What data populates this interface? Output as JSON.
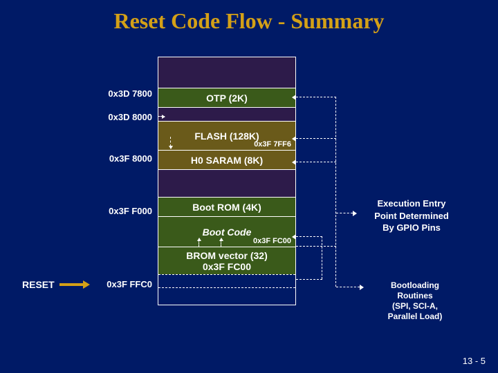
{
  "title": "Reset Code Flow - Summary",
  "addresses": {
    "otp": "0x3D 7800",
    "gap2": "0x3D 8000",
    "h0saram": "0x3F 8000",
    "bootrom": "0x3F F000",
    "bromvec": "0x3F FFC0"
  },
  "blocks": {
    "otp": "OTP (2K)",
    "flash": "FLASH (128K)",
    "flash_end_addr": "0x3F 7FF6",
    "h0saram": "H0 SARAM (8K)",
    "bootrom": "Boot ROM (4K)",
    "bootcode": "Boot Code",
    "bootcode_addr": "0x3F FC00",
    "bromvec_l1": "BROM vector (32)",
    "bromvec_l2": "0x3F FC00"
  },
  "reset_label": "RESET",
  "exec_entry": {
    "l1": "Execution Entry",
    "l2": "Point Determined",
    "l3": "By GPIO Pins"
  },
  "bootloading": {
    "l1": "Bootloading",
    "l2": "Routines",
    "l3": "(SPI, SCI-A,",
    "l4": "Parallel Load)"
  },
  "footer": "13 - 5"
}
